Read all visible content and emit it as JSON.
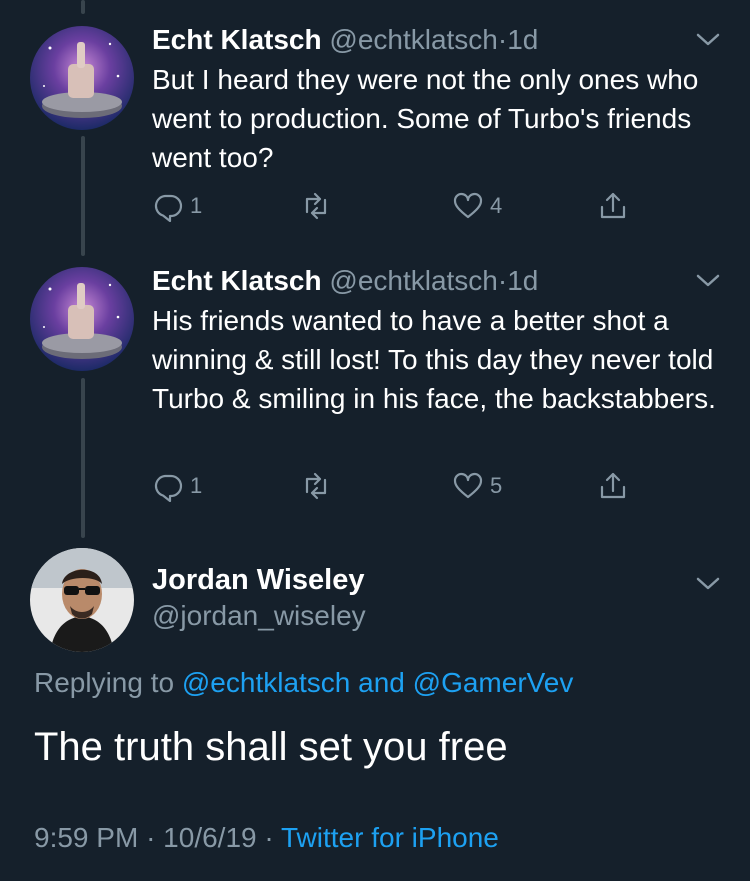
{
  "tweets": [
    {
      "name": "Echt Klatsch",
      "handle": "@echtklatsch",
      "separator": "·",
      "time": "1d",
      "text": "But I heard they were not the only ones who went to production. Some of Turbo's friends went too?",
      "replies": "1",
      "retweets": "",
      "likes": "4"
    },
    {
      "name": "Echt Klatsch",
      "handle": "@echtklatsch",
      "separator": "·",
      "time": "1d",
      "text": "His friends wanted to have a better shot a winning & still lost!  To this day they never told Turbo & smiling in his face, the backstabbers.",
      "replies": "1",
      "retweets": "",
      "likes": "5"
    }
  ],
  "main_tweet": {
    "name": "Jordan Wiseley",
    "handle": "@jordan_wiseley",
    "replying_prefix": "Replying to",
    "replying_user1": "@echtklatsch",
    "replying_and": "and",
    "replying_user2": "@GamerVev",
    "text": "The truth shall set you free",
    "time": "9:59 PM",
    "sep1": "·",
    "date": "10/6/19",
    "sep2": "·",
    "source": "Twitter for iPhone"
  },
  "icons": {
    "reply": "reply-icon",
    "retweet": "retweet-icon",
    "like": "heart-icon",
    "share": "share-icon",
    "caret": "chevron-down-icon"
  },
  "colors": {
    "background": "#15202b",
    "secondary_text": "#8899a6",
    "link": "#1da1f2",
    "thread_line": "#38444d"
  }
}
